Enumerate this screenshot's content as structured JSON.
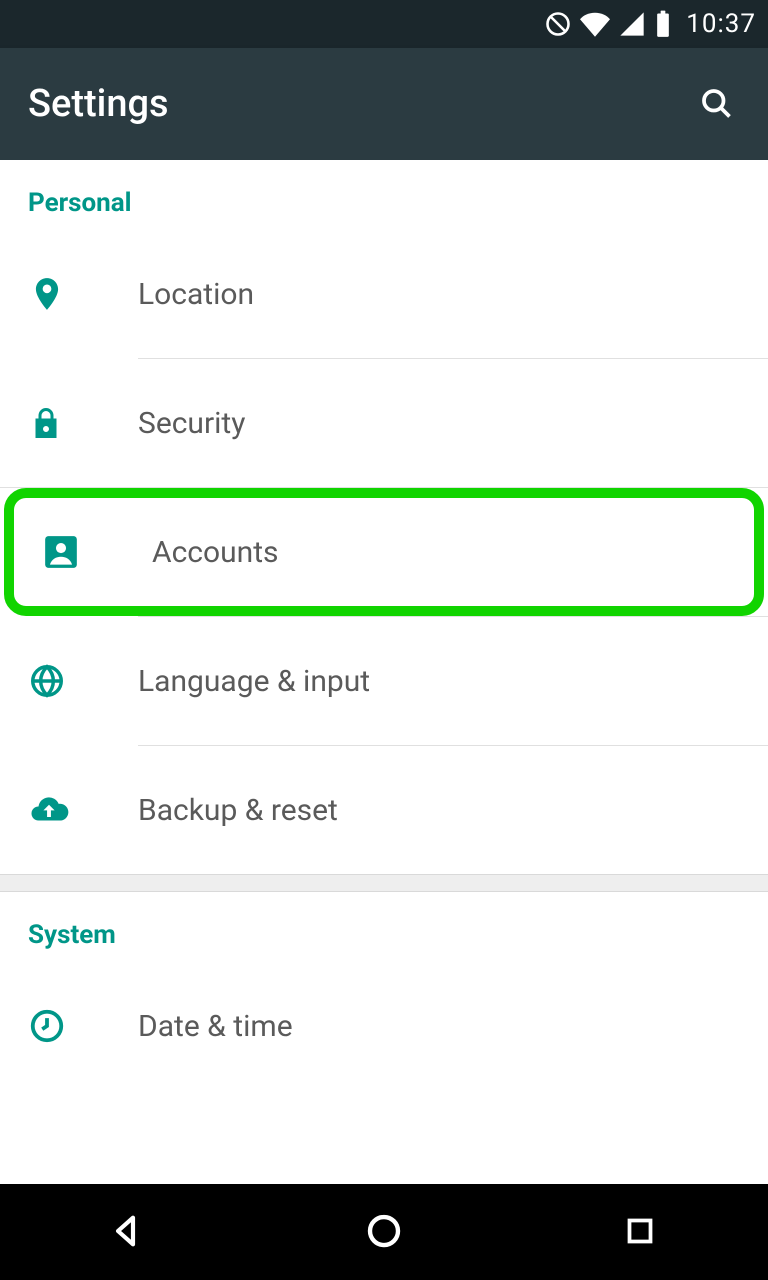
{
  "status": {
    "time": "10:37"
  },
  "appbar": {
    "title": "Settings"
  },
  "sections": {
    "personal": {
      "header": "Personal",
      "items": [
        {
          "label": "Location"
        },
        {
          "label": "Security"
        },
        {
          "label": "Accounts"
        },
        {
          "label": "Language & input"
        },
        {
          "label": "Backup & reset"
        }
      ]
    },
    "system": {
      "header": "System",
      "items": [
        {
          "label": "Date & time"
        }
      ]
    }
  },
  "accent_color": "#009688"
}
